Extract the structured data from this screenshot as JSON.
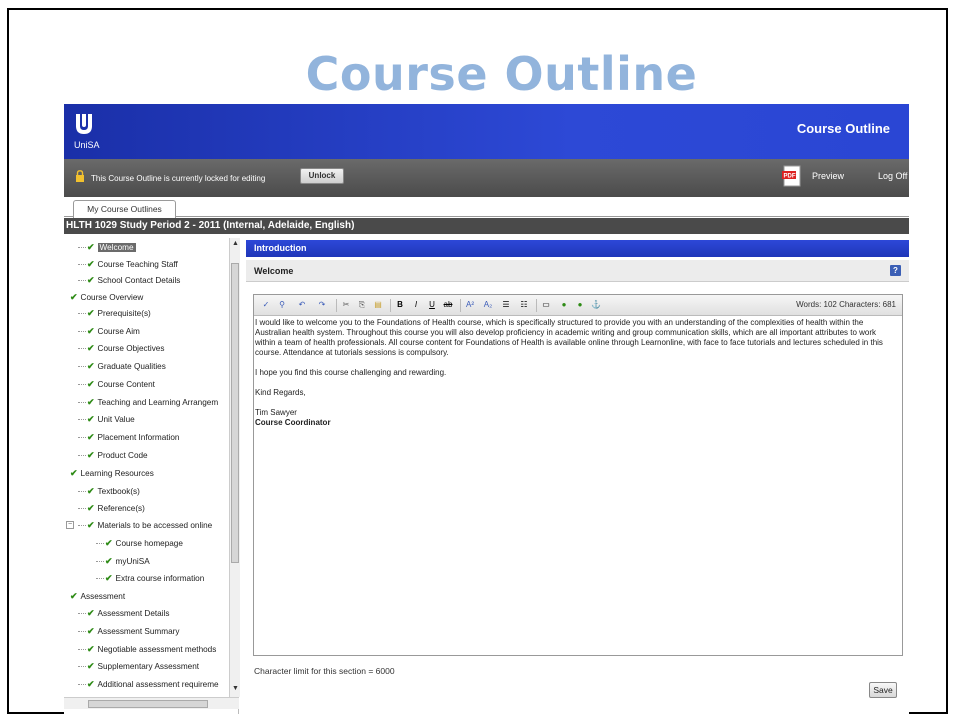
{
  "slide": {
    "title": "Course Outline"
  },
  "banner": {
    "logo_text": "UniSA",
    "title": "Course Outline"
  },
  "lockbar": {
    "message": "This Course Outline is currently locked for editing",
    "unlock_label": "Unlock",
    "preview_label": "Preview",
    "logoff_label": "Log Off"
  },
  "tabs": {
    "active": "My Course Outlines"
  },
  "course_bar": "HLTH 1029 Study Period 2 - 2011 (Internal, Adelaide, English)",
  "tree": {
    "items": [
      {
        "label": "Welcome"
      },
      {
        "label": "Course Teaching Staff"
      },
      {
        "label": "School Contact Details"
      },
      {
        "label": "Course Overview"
      },
      {
        "label": "Prerequisite(s)"
      },
      {
        "label": "Course Aim"
      },
      {
        "label": "Course Objectives"
      },
      {
        "label": "Graduate Qualities"
      },
      {
        "label": "Course Content"
      },
      {
        "label": "Teaching and Learning Arrangem"
      },
      {
        "label": "Unit Value"
      },
      {
        "label": "Placement Information"
      },
      {
        "label": "Product Code"
      },
      {
        "label": "Learning Resources"
      },
      {
        "label": "Textbook(s)"
      },
      {
        "label": "Reference(s)"
      },
      {
        "label": "Materials to be accessed online"
      },
      {
        "label": "Course homepage"
      },
      {
        "label": "myUniSA"
      },
      {
        "label": "Extra course information"
      },
      {
        "label": "Assessment"
      },
      {
        "label": "Assessment Details"
      },
      {
        "label": "Assessment Summary"
      },
      {
        "label": "Negotiable assessment methods"
      },
      {
        "label": "Supplementary Assessment"
      },
      {
        "label": "Additional assessment requireme"
      }
    ]
  },
  "content": {
    "section_title": "Introduction",
    "subsection_title": "Welcome",
    "word_count": "Words: 102  Characters: 681",
    "body": {
      "p1": "I would like to welcome you to the Foundations of Health course, which is specifically structured to provide you with an understanding of the complexities of health within the Australian health system. Throughout this course you will also develop proficiency in academic writing and group communication skills, which are all important attributes to work within a team of health professionals. All course content for Foundations of Health is available online through Learnonline, with face to face tutorials and lectures scheduled in this course. Attendance at tutorials sessions is compulsory.",
      "p2": "I hope you find this course challenging and rewarding.",
      "p3": "Kind Regards,",
      "name": "Tim Sawyer",
      "role": "Course Coordinator"
    },
    "char_limit": "Character limit for this section = 6000",
    "save_label": "Save"
  },
  "colors": {
    "banner": "#2a46d4",
    "slide_title": "#92b4dc",
    "check": "#2e8b16"
  }
}
